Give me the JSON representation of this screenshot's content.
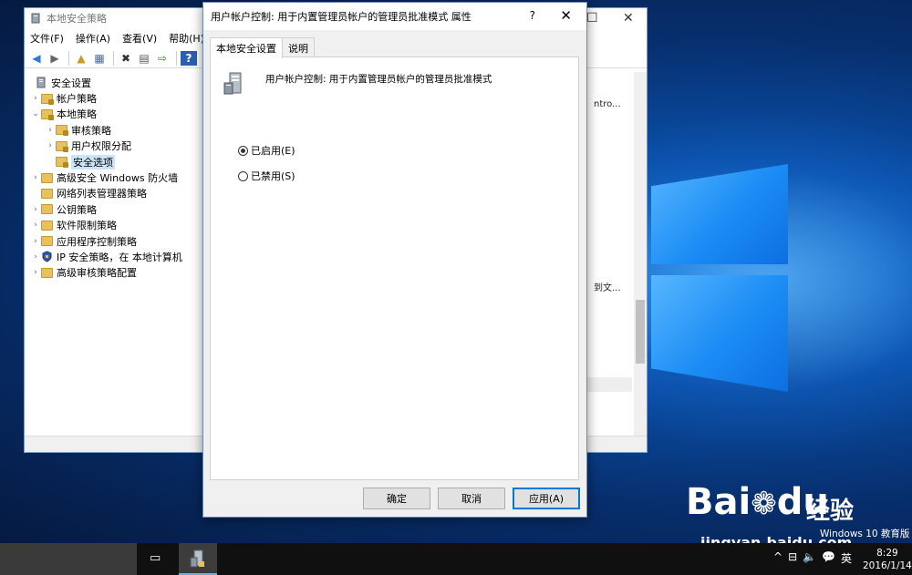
{
  "background_window": {
    "title": "本地安全策略",
    "controls": {
      "restore": "☐",
      "close": "✕"
    },
    "menu": [
      "文件(F)",
      "操作(A)",
      "查看(V)",
      "帮助(H)"
    ],
    "tree": {
      "root": "安全设置",
      "items": [
        {
          "label": "帐户策略",
          "indent": 1,
          "arrow": "›"
        },
        {
          "label": "本地策略",
          "indent": 1,
          "arrow": "⌄"
        },
        {
          "label": "审核策略",
          "indent": 2,
          "arrow": "›"
        },
        {
          "label": "用户权限分配",
          "indent": 2,
          "arrow": "›"
        },
        {
          "label": "安全选项",
          "indent": 2,
          "arrow": "",
          "selected": true
        },
        {
          "label": "高级安全 Windows 防火墙",
          "indent": 1,
          "arrow": "›"
        },
        {
          "label": "网络列表管理器策略",
          "indent": 1,
          "arrow": ""
        },
        {
          "label": "公钥策略",
          "indent": 1,
          "arrow": "›"
        },
        {
          "label": "软件限制策略",
          "indent": 1,
          "arrow": "›"
        },
        {
          "label": "应用程序控制策略",
          "indent": 1,
          "arrow": "›"
        },
        {
          "label": "IP 安全策略，在 本地计算机",
          "indent": 1,
          "arrow": "›"
        },
        {
          "label": "高级审核策略配置",
          "indent": 1,
          "arrow": "›"
        }
      ]
    },
    "right_pane_fragments": [
      "ntro...",
      "到文..."
    ]
  },
  "dialog": {
    "title": "用户帐户控制: 用于内置管理员帐户的管理员批准模式 属性",
    "help": "?",
    "close": "✕",
    "tabs": [
      "本地安全设置",
      "说明"
    ],
    "active_tab": 0,
    "policy_title": "用户帐户控制: 用于内置管理员帐户的管理员批准模式",
    "options": [
      {
        "label": "已启用(E)",
        "checked": true
      },
      {
        "label": "已禁用(S)",
        "checked": false
      }
    ],
    "buttons": {
      "ok": "确定",
      "cancel": "取消",
      "apply": "应用(A)"
    }
  },
  "watermark": {
    "logo": "Bai",
    "logo2": "du",
    "cn": "经验",
    "url": "jingyan.baidu.com"
  },
  "edition_text": "Windows 10 教育版",
  "taskbar": {
    "tray_icons": [
      "^",
      "⊟",
      "🔈",
      "💬",
      "英"
    ],
    "time": "8:29",
    "date": "2016/1/14"
  },
  "colors": {
    "accent": "#0078d7",
    "selection": "#cce4f7",
    "folder": "#e8c15a"
  }
}
